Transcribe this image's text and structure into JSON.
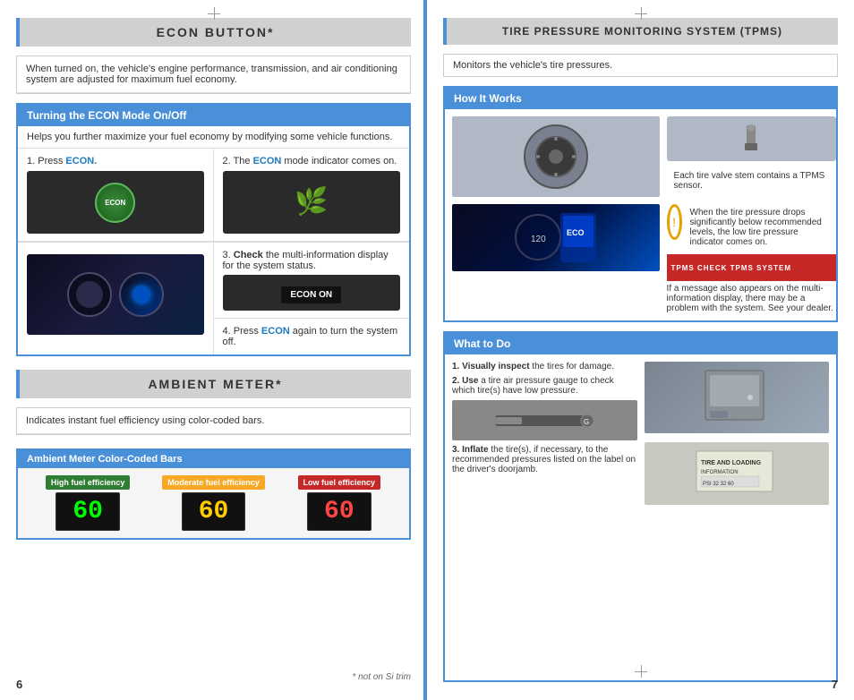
{
  "left_page": {
    "page_number": "6",
    "econ_section": {
      "title": "ECON BUTTON*",
      "description": "When turned on, the vehicle's engine performance, transmission, and air conditioning system are adjusted for maximum fuel economy.",
      "turning_section": {
        "title": "Turning the ECON Mode On/Off",
        "subtitle": "Helps you further maximize your fuel economy by modifying some vehicle functions.",
        "step1_label": "1. Press",
        "step1_highlight": "ECON.",
        "step2_label": "2. The",
        "step2_highlight": "ECON",
        "step2_rest": "mode indicator comes on.",
        "step3_label": "3.",
        "step3_bold": "Check",
        "step3_rest": "the multi-information display for the system status.",
        "step4_label": "4. Press",
        "step4_highlight": "ECON",
        "step4_rest": "again to turn the system off.",
        "econ_on_text": "ECON ON"
      }
    },
    "ambient_section": {
      "title": "AMBIENT METER*",
      "description": "Indicates instant fuel efficiency using color-coded bars.",
      "bars_section": {
        "title": "Ambient Meter Color-Coded Bars",
        "bar1_label": "High fuel efficiency",
        "bar1_value": "60",
        "bar2_label": "Moderate fuel efficiency",
        "bar2_value": "60",
        "bar3_label": "Low fuel efficiency",
        "bar3_value": "60"
      }
    },
    "footnote": "* not on Si trim"
  },
  "right_page": {
    "page_number": "7",
    "tpms_section": {
      "title": "TIRE PRESSURE MONITORING SYSTEM (TPMS)",
      "description": "Monitors the vehicle's tire pressures.",
      "how_it_works": {
        "title": "How It Works",
        "text1": "Each tire valve stem contains a TPMS sensor.",
        "text2": "When the tire pressure drops significantly below recommended levels, the low tire pressure indicator comes on.",
        "text3": "If a message also appears on the multi-information display, there may be a problem with the system. See your dealer.",
        "tpms_bar_text": "TPMS  CHECK TPMS SYSTEM"
      },
      "what_to_do": {
        "title": "What to Do",
        "step1": "1. Visually inspect the tires for damage.",
        "step2": "2. Use a tire air pressure gauge to check which tire(s) have low pressure.",
        "step3": "3. Inflate the tire(s), if necessary, to the recommended pressures listed on the label on the driver's doorjamb."
      }
    }
  }
}
